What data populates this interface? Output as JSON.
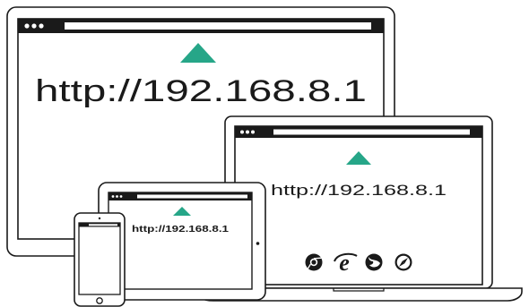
{
  "devices": {
    "monitor": {
      "url": "http://192.168.8.1"
    },
    "laptop": {
      "url": "http://192.168.8.1"
    },
    "tablet": {
      "url": "http://192.168.8.1"
    }
  },
  "browser_icons": [
    "chrome-icon",
    "internet-explorer-icon",
    "firefox-icon",
    "safari-icon"
  ],
  "colors": {
    "accent": "#26a688",
    "outline": "#1a1a1a",
    "background": "#ffffff"
  }
}
